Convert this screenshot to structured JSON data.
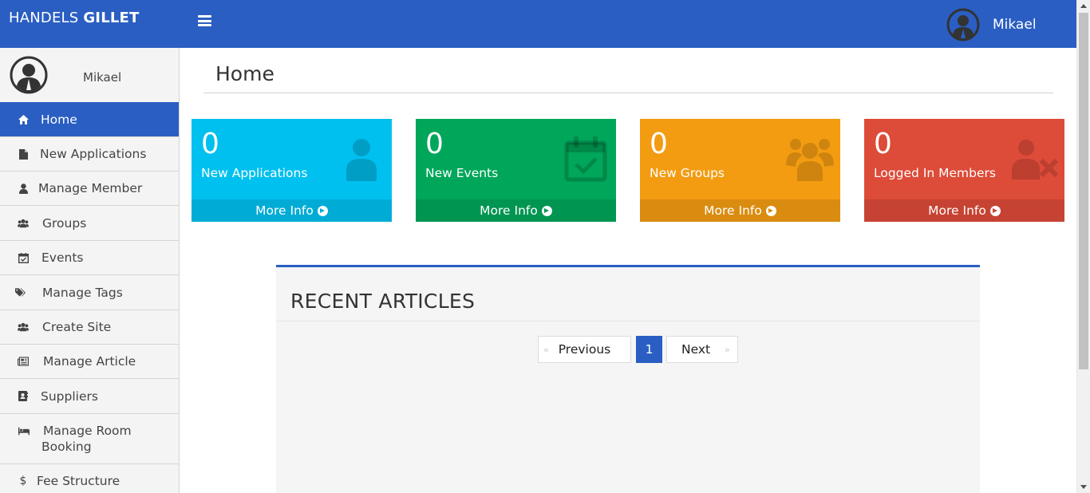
{
  "header": {
    "brand_light": "HANDELS ",
    "brand_bold": "GILLET",
    "user_name": "Mikael"
  },
  "sidebar": {
    "user_name": "Mikael",
    "items": [
      {
        "label": "Home",
        "icon": "home-icon",
        "active": true
      },
      {
        "label": "New Applications",
        "icon": "file-icon"
      },
      {
        "label": "Manage Member",
        "icon": "user-icon"
      },
      {
        "label": "Groups",
        "icon": "users-icon"
      },
      {
        "label": "Events",
        "icon": "calendar-check-icon"
      },
      {
        "label": "Manage Tags",
        "icon": "tags-icon"
      },
      {
        "label": "Create Site",
        "icon": "users-icon"
      },
      {
        "label": "Manage Article",
        "icon": "newspaper-icon"
      },
      {
        "label": "Suppliers",
        "icon": "address-book-icon"
      },
      {
        "label": "Manage Room",
        "label2": "Booking",
        "icon": "bed-icon"
      },
      {
        "label": "Fee Structure",
        "icon": "dollar-icon"
      }
    ]
  },
  "main": {
    "title": "Home",
    "stats": [
      {
        "count": "0",
        "label": "New Applications",
        "more": "More Info",
        "color": "#00c0ef",
        "footer_color": "#00acd6",
        "icon": "user-icon"
      },
      {
        "count": "0",
        "label": "New Events",
        "more": "More Info",
        "color": "#00a65a",
        "footer_color": "#009551",
        "icon": "calendar-check-icon"
      },
      {
        "count": "0",
        "label": "New Groups",
        "more": "More Info",
        "color": "#f39c12",
        "footer_color": "#da8c10",
        "icon": "users-icon"
      },
      {
        "count": "0",
        "label": "Logged In Members",
        "more": "More Info",
        "color": "#dd4b39",
        "footer_color": "#c64333",
        "icon": "user-times-icon"
      }
    ],
    "articles": {
      "title": "RECENT ARTICLES",
      "pagination": {
        "prev_glyph": "«",
        "prev": "Previous",
        "current": "1",
        "next": "Next",
        "next_glyph": "»"
      }
    }
  },
  "colors": {
    "primary": "#2a5ec2",
    "sidebar_bg": "#f4f4f4"
  }
}
